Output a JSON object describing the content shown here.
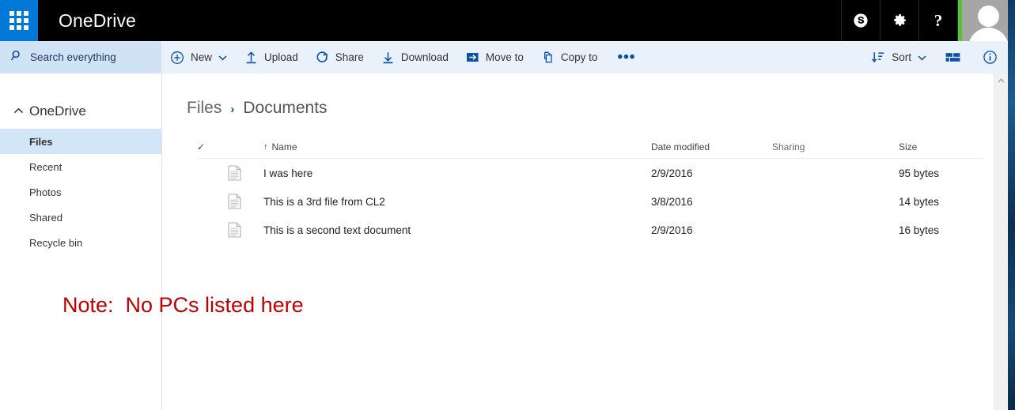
{
  "suite": {
    "app_launcher": "app-launcher",
    "brand": "OneDrive",
    "actions": [
      {
        "name": "skype-icon",
        "label": "Skype"
      },
      {
        "name": "settings-gear-icon",
        "label": "Settings"
      },
      {
        "name": "help-icon",
        "label": "?"
      }
    ],
    "account": {
      "name": "account-avatar",
      "presence_color": "#5bc236"
    }
  },
  "search": {
    "placeholder": "Search everything",
    "icon": "search-icon",
    "value": ""
  },
  "commandbar": {
    "items": [
      {
        "label": "New",
        "icon": "plus-circle-icon",
        "has_caret": true
      },
      {
        "label": "Upload",
        "icon": "upload-arrow-icon",
        "has_caret": false
      },
      {
        "label": "Share",
        "icon": "share-circle-icon",
        "has_caret": false
      },
      {
        "label": "Download",
        "icon": "download-arrow-icon",
        "has_caret": false
      },
      {
        "label": "Move to",
        "icon": "move-to-arrow-icon",
        "has_caret": false
      },
      {
        "label": "Copy to",
        "icon": "copy-pages-icon",
        "has_caret": false
      }
    ],
    "overflow_label": "•••",
    "sort": {
      "label": "Sort",
      "icon": "sort-arrow-icon",
      "has_caret": true
    },
    "view_toggle": {
      "name": "view-tiles-icon",
      "label": "Change view"
    },
    "info": {
      "name": "info-circle-icon",
      "label": "Information"
    }
  },
  "sidebar": {
    "root": {
      "label": "OneDrive",
      "chevron": "chevron-up-icon"
    },
    "items": [
      {
        "label": "Files",
        "selected": true
      },
      {
        "label": "Recent",
        "selected": false
      },
      {
        "label": "Photos",
        "selected": false
      },
      {
        "label": "Shared",
        "selected": false
      },
      {
        "label": "Recycle bin",
        "selected": false
      }
    ]
  },
  "breadcrumb": {
    "separator": "›",
    "crumbs": [
      "Files",
      "Documents"
    ]
  },
  "filetable": {
    "headers": {
      "select_all": "✓",
      "name": "Name",
      "name_sort_arrow": "↑",
      "date_modified": "Date modified",
      "sharing": "Sharing",
      "size": "Size"
    },
    "rows": [
      {
        "icon": "text-document-icon",
        "name": "I was here",
        "date_modified": "2/9/2016",
        "sharing": "",
        "size": "95 bytes"
      },
      {
        "icon": "text-document-icon",
        "name": "This is a 3rd file from CL2",
        "date_modified": "3/8/2016",
        "sharing": "",
        "size": "14 bytes"
      },
      {
        "icon": "text-document-icon",
        "name": "This is a second text document",
        "date_modified": "2/9/2016",
        "sharing": "",
        "size": "16 bytes"
      }
    ]
  },
  "annotation": {
    "text": "Note:  No PCs listed here",
    "color": "#c00000"
  },
  "scrollbar": {
    "up_arrow": "⌃"
  }
}
